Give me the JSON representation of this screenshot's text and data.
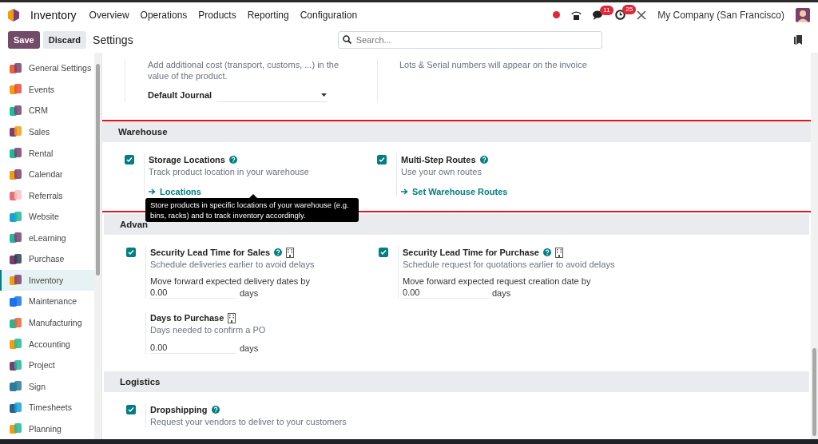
{
  "navbar": {
    "app_name": "Inventory",
    "menu": [
      "Overview",
      "Operations",
      "Products",
      "Reporting",
      "Configuration"
    ],
    "indicators": [
      {
        "kind": "status"
      },
      {
        "kind": "phone"
      },
      {
        "kind": "chat",
        "badge": "11"
      },
      {
        "kind": "activity",
        "badge": "25"
      },
      {
        "kind": "tools"
      }
    ],
    "company": "My Company (San Francisco)"
  },
  "control_panel": {
    "buttons": [
      {
        "label": "Save",
        "kind": "primary"
      },
      {
        "label": "Discard",
        "kind": "secondary"
      }
    ],
    "title": "Settings",
    "search": {
      "placeholder": "Search..."
    }
  },
  "sidebar": {
    "items": [
      {
        "label": "General Settings",
        "selected": false
      },
      {
        "label": "Events",
        "selected": false
      },
      {
        "label": "CRM",
        "selected": false
      },
      {
        "label": "Sales",
        "selected": false
      },
      {
        "label": "Rental",
        "selected": false
      },
      {
        "label": "Calendar",
        "selected": false
      },
      {
        "label": "Referrals",
        "selected": false
      },
      {
        "label": "Website",
        "selected": false
      },
      {
        "label": "eLearning",
        "selected": false
      },
      {
        "label": "Purchase",
        "selected": false
      },
      {
        "label": "Inventory",
        "selected": true
      },
      {
        "label": "Maintenance",
        "selected": false
      },
      {
        "label": "Manufacturing",
        "selected": false
      },
      {
        "label": "Accounting",
        "selected": false
      },
      {
        "label": "Project",
        "selected": false
      },
      {
        "label": "Sign",
        "selected": false
      },
      {
        "label": "Timesheets",
        "selected": false
      },
      {
        "label": "Planning",
        "selected": false
      }
    ]
  },
  "top_block": {
    "left": {
      "description": "Add additional cost (transport, customs, ...) in the value of the product.",
      "field_label": "Default Journal"
    },
    "right": {
      "description": "Lots & Serial numbers will appear on the invoice"
    }
  },
  "sections": [
    {
      "title": "Warehouse",
      "highlighted": true,
      "settings": [
        {
          "kind": "checkbox",
          "title": "Storage Locations",
          "checked": true,
          "help": true,
          "company_icon": false,
          "description": "Track product location in your warehouse",
          "link": "Locations",
          "tooltip": "Store products in specific locations of your warehouse (e.g. bins, racks) and to track inventory accordingly."
        },
        {
          "kind": "checkbox",
          "title": "Multi-Step Routes",
          "checked": true,
          "help": true,
          "company_icon": false,
          "description": "Use your own routes",
          "link": "Set Warehouse Routes"
        }
      ]
    },
    {
      "title": "Advan",
      "highlighted": false,
      "settings": [
        {
          "kind": "checkbox",
          "title": "Security Lead Time for Sales",
          "checked": true,
          "help": true,
          "company_icon": true,
          "description": "Schedule deliveries earlier to avoid delays",
          "field_label": "Move forward expected delivery dates by",
          "value": "0.00",
          "unit": "days"
        },
        {
          "kind": "checkbox",
          "title": "Security Lead Time for Purchase",
          "checked": true,
          "help": true,
          "company_icon": true,
          "description": "Schedule request for quotations earlier to avoid delays",
          "field_label": "Move forward expected request creation date by",
          "value": "0.00",
          "unit": "days"
        },
        {
          "kind": "field",
          "title": "Days to Purchase",
          "help": false,
          "company_icon": true,
          "description": "Days needed to confirm a PO",
          "value": "0.00",
          "unit": "days"
        }
      ]
    },
    {
      "title": "Logistics",
      "highlighted": false,
      "settings": [
        {
          "kind": "checkbox",
          "title": "Dropshipping",
          "checked": true,
          "help": true,
          "company_icon": false,
          "description": "Request your vendors to deliver to your customers"
        }
      ]
    }
  ]
}
